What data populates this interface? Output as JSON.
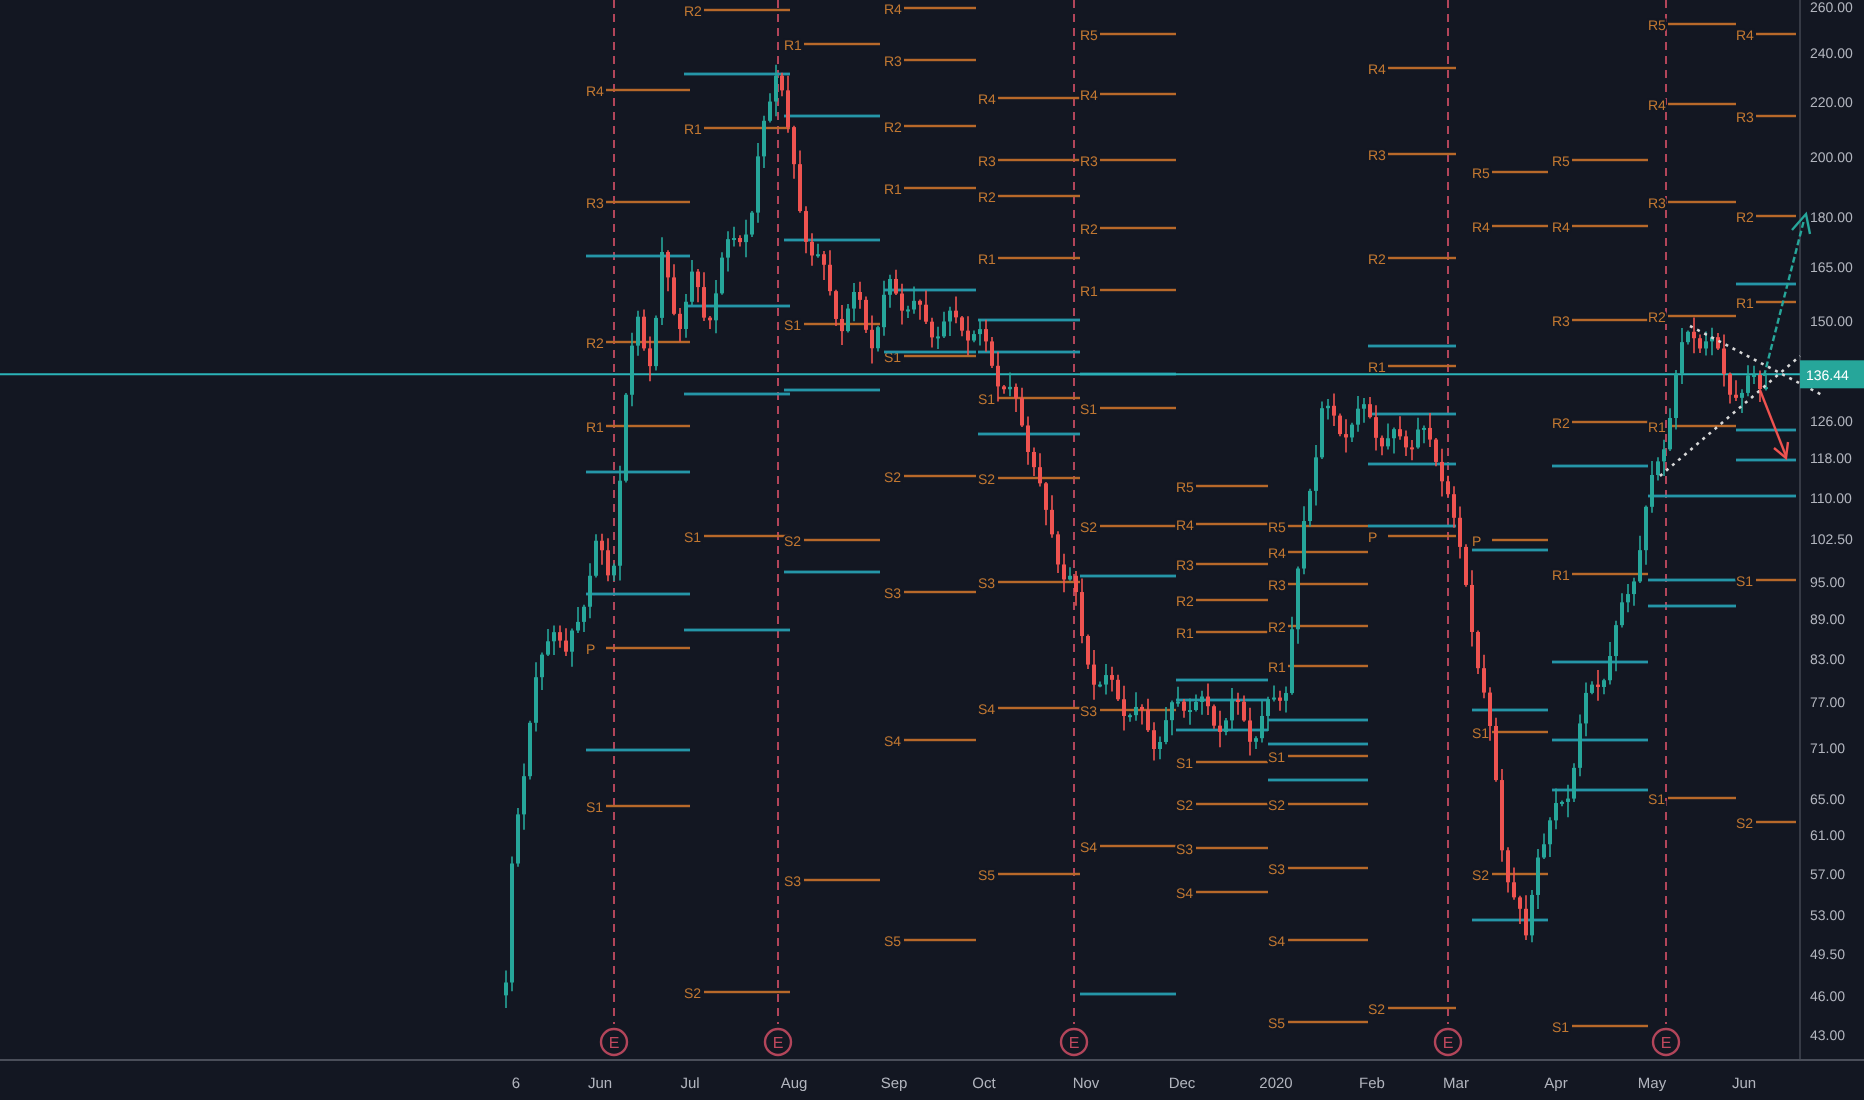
{
  "chart": {
    "current_price": "136.44",
    "price_axis": [
      "260.00",
      "240.00",
      "220.00",
      "200.00",
      "180.00",
      "165.00",
      "150.00",
      "126.00",
      "118.00",
      "110.00",
      "102.50",
      "95.00",
      "89.00",
      "83.00",
      "77.00",
      "71.00",
      "65.00",
      "61.00",
      "57.00",
      "53.00",
      "49.50",
      "46.00",
      "43.00"
    ],
    "time_axis": [
      "6",
      "Jun",
      "Jul",
      "Aug",
      "Sep",
      "Oct",
      "Nov",
      "Dec",
      "2020",
      "Feb",
      "Mar",
      "Apr",
      "May",
      "Jun"
    ],
    "earnings_markers": [
      {
        "label": "E"
      },
      {
        "label": "E"
      },
      {
        "label": "E"
      },
      {
        "label": "E"
      },
      {
        "label": "E"
      }
    ],
    "pivot_periods": [
      {
        "levels": [
          {
            "kind": "pivot",
            "label": "R4"
          },
          {
            "kind": "pivot",
            "label": "R3"
          },
          {
            "kind": "pivot",
            "label": "R2"
          },
          {
            "kind": "pivot",
            "label": "R1"
          },
          {
            "kind": "pivot",
            "label": "P"
          },
          {
            "kind": "pivot",
            "label": "S1"
          },
          {
            "kind": "band"
          },
          {
            "kind": "band"
          },
          {
            "kind": "band"
          },
          {
            "kind": "band"
          }
        ]
      },
      {
        "levels": [
          {
            "kind": "pivot",
            "label": "R2"
          },
          {
            "kind": "pivot",
            "label": "R1"
          },
          {
            "kind": "pivot",
            "label": "S1"
          },
          {
            "kind": "pivot",
            "label": "S2"
          },
          {
            "kind": "band"
          },
          {
            "kind": "band"
          },
          {
            "kind": "band"
          },
          {
            "kind": "band"
          }
        ]
      },
      {
        "levels": [
          {
            "kind": "pivot",
            "label": "R1"
          },
          {
            "kind": "pivot",
            "label": "S1"
          },
          {
            "kind": "pivot",
            "label": "S2"
          },
          {
            "kind": "pivot",
            "label": "S3"
          },
          {
            "kind": "band"
          },
          {
            "kind": "band"
          },
          {
            "kind": "band"
          },
          {
            "kind": "band"
          }
        ]
      },
      {
        "levels": [
          {
            "kind": "pivot",
            "label": "R4"
          },
          {
            "kind": "pivot",
            "label": "R3"
          },
          {
            "kind": "pivot",
            "label": "R2"
          },
          {
            "kind": "pivot",
            "label": "R1"
          },
          {
            "kind": "pivot",
            "label": "S1"
          },
          {
            "kind": "pivot",
            "label": "S2"
          },
          {
            "kind": "pivot",
            "label": "S3"
          },
          {
            "kind": "pivot",
            "label": "S4"
          },
          {
            "kind": "pivot",
            "label": "S5"
          },
          {
            "kind": "band"
          },
          {
            "kind": "band"
          }
        ]
      },
      {
        "levels": [
          {
            "kind": "pivot",
            "label": "R4"
          },
          {
            "kind": "pivot",
            "label": "R3"
          },
          {
            "kind": "pivot",
            "label": "R2"
          },
          {
            "kind": "pivot",
            "label": "R1"
          },
          {
            "kind": "pivot",
            "label": "S1"
          },
          {
            "kind": "pivot",
            "label": "S2"
          },
          {
            "kind": "pivot",
            "label": "S3"
          },
          {
            "kind": "pivot",
            "label": "S4"
          },
          {
            "kind": "pivot",
            "label": "S5"
          },
          {
            "kind": "band"
          },
          {
            "kind": "band"
          },
          {
            "kind": "band"
          }
        ]
      },
      {
        "levels": [
          {
            "kind": "pivot",
            "label": "R5"
          },
          {
            "kind": "pivot",
            "label": "R4"
          },
          {
            "kind": "pivot",
            "label": "R3"
          },
          {
            "kind": "pivot",
            "label": "R2"
          },
          {
            "kind": "pivot",
            "label": "R1"
          },
          {
            "kind": "pivot",
            "label": "S1"
          },
          {
            "kind": "pivot",
            "label": "S2"
          },
          {
            "kind": "pivot",
            "label": "S3"
          },
          {
            "kind": "pivot",
            "label": "S4"
          },
          {
            "kind": "band"
          },
          {
            "kind": "band"
          },
          {
            "kind": "band"
          }
        ]
      },
      {
        "levels": [
          {
            "kind": "pivot",
            "label": "R5"
          },
          {
            "kind": "pivot",
            "label": "R4"
          },
          {
            "kind": "pivot",
            "label": "R3"
          },
          {
            "kind": "pivot",
            "label": "R2"
          },
          {
            "kind": "pivot",
            "label": "R1"
          },
          {
            "kind": "pivot",
            "label": "S1"
          },
          {
            "kind": "pivot",
            "label": "S2"
          },
          {
            "kind": "pivot",
            "label": "S3"
          },
          {
            "kind": "pivot",
            "label": "S4"
          },
          {
            "kind": "band"
          },
          {
            "kind": "band"
          },
          {
            "kind": "band"
          }
        ]
      },
      {
        "levels": [
          {
            "kind": "pivot",
            "label": "R5"
          },
          {
            "kind": "pivot",
            "label": "R4"
          },
          {
            "kind": "pivot",
            "label": "R3"
          },
          {
            "kind": "pivot",
            "label": "R2"
          },
          {
            "kind": "pivot",
            "label": "R1"
          },
          {
            "kind": "pivot",
            "label": "S1"
          },
          {
            "kind": "pivot",
            "label": "S2"
          },
          {
            "kind": "pivot",
            "label": "S3"
          },
          {
            "kind": "pivot",
            "label": "S4"
          },
          {
            "kind": "pivot",
            "label": "S5"
          },
          {
            "kind": "band"
          },
          {
            "kind": "band"
          },
          {
            "kind": "band"
          }
        ]
      },
      {
        "levels": [
          {
            "kind": "pivot",
            "label": "R4"
          },
          {
            "kind": "pivot",
            "label": "R3"
          },
          {
            "kind": "pivot",
            "label": "R2"
          },
          {
            "kind": "pivot",
            "label": "R1"
          },
          {
            "kind": "pivot",
            "label": "P"
          },
          {
            "kind": "pivot",
            "label": "S2"
          },
          {
            "kind": "band"
          },
          {
            "kind": "band"
          },
          {
            "kind": "band"
          },
          {
            "kind": "band"
          }
        ]
      },
      {
        "levels": [
          {
            "kind": "pivot",
            "label": "R5"
          },
          {
            "kind": "pivot",
            "label": "R4"
          },
          {
            "kind": "pivot",
            "label": "P"
          },
          {
            "kind": "pivot",
            "label": "S1"
          },
          {
            "kind": "pivot",
            "label": "S2"
          },
          {
            "kind": "band"
          },
          {
            "kind": "band"
          },
          {
            "kind": "band"
          }
        ]
      },
      {
        "levels": [
          {
            "kind": "pivot",
            "label": "R5"
          },
          {
            "kind": "pivot",
            "label": "R4"
          },
          {
            "kind": "pivot",
            "label": "R3"
          },
          {
            "kind": "pivot",
            "label": "R2"
          },
          {
            "kind": "pivot",
            "label": "R1"
          },
          {
            "kind": "pivot",
            "label": "S1"
          },
          {
            "kind": "band"
          },
          {
            "kind": "band"
          },
          {
            "kind": "band"
          },
          {
            "kind": "band"
          }
        ]
      },
      {
        "levels": [
          {
            "kind": "pivot",
            "label": "R5"
          },
          {
            "kind": "pivot",
            "label": "R4"
          },
          {
            "kind": "pivot",
            "label": "R3"
          },
          {
            "kind": "pivot",
            "label": "R2"
          },
          {
            "kind": "pivot",
            "label": "R1"
          },
          {
            "kind": "pivot",
            "label": "S1"
          },
          {
            "kind": "band"
          },
          {
            "kind": "band"
          },
          {
            "kind": "band"
          }
        ]
      },
      {
        "levels": [
          {
            "kind": "pivot",
            "label": "R4"
          },
          {
            "kind": "pivot",
            "label": "R3"
          },
          {
            "kind": "pivot",
            "label": "R2"
          },
          {
            "kind": "pivot",
            "label": "R1"
          },
          {
            "kind": "pivot",
            "label": "S1"
          },
          {
            "kind": "pivot",
            "label": "S2"
          },
          {
            "kind": "band"
          },
          {
            "kind": "band"
          },
          {
            "kind": "band"
          },
          {
            "kind": "band"
          }
        ]
      }
    ]
  }
}
